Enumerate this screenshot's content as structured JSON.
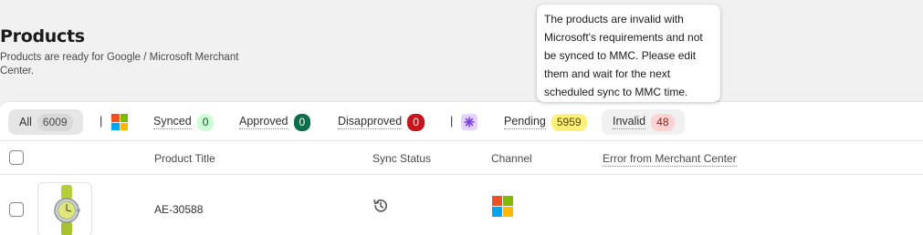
{
  "header": {
    "title": "Products",
    "subtitle": "Products are ready for Google / Microsoft Merchant Center."
  },
  "tabs": {
    "all": {
      "label": "All",
      "count": "6009"
    },
    "synced": {
      "label": "Synced",
      "count": "0"
    },
    "approved": {
      "label": "Approved",
      "count": "0"
    },
    "disapproved": {
      "label": "Disapproved",
      "count": "0"
    },
    "pending": {
      "label": "Pending",
      "count": "5959"
    },
    "invalid": {
      "label": "Invalid",
      "count": "48"
    },
    "separator": "|"
  },
  "tooltip": {
    "text": "The products are invalid with Microsoft's requirements and not be synced to MMC. Please edit them and wait for the next scheduled sync to MMC time."
  },
  "table": {
    "columns": [
      "Product Title",
      "Sync Status",
      "Channel",
      "Error from Merchant Center"
    ],
    "rows": [
      {
        "title": "AE-30588",
        "sync_status_icon": "history-icon",
        "channel_icon": "microsoft-icon",
        "error": ""
      }
    ]
  },
  "colors": {
    "ms_red": "#f25022",
    "ms_green": "#7fba00",
    "ms_blue": "#00a4ef",
    "ms_yellow": "#ffb900",
    "spark_purple": "#7b3fe4"
  }
}
